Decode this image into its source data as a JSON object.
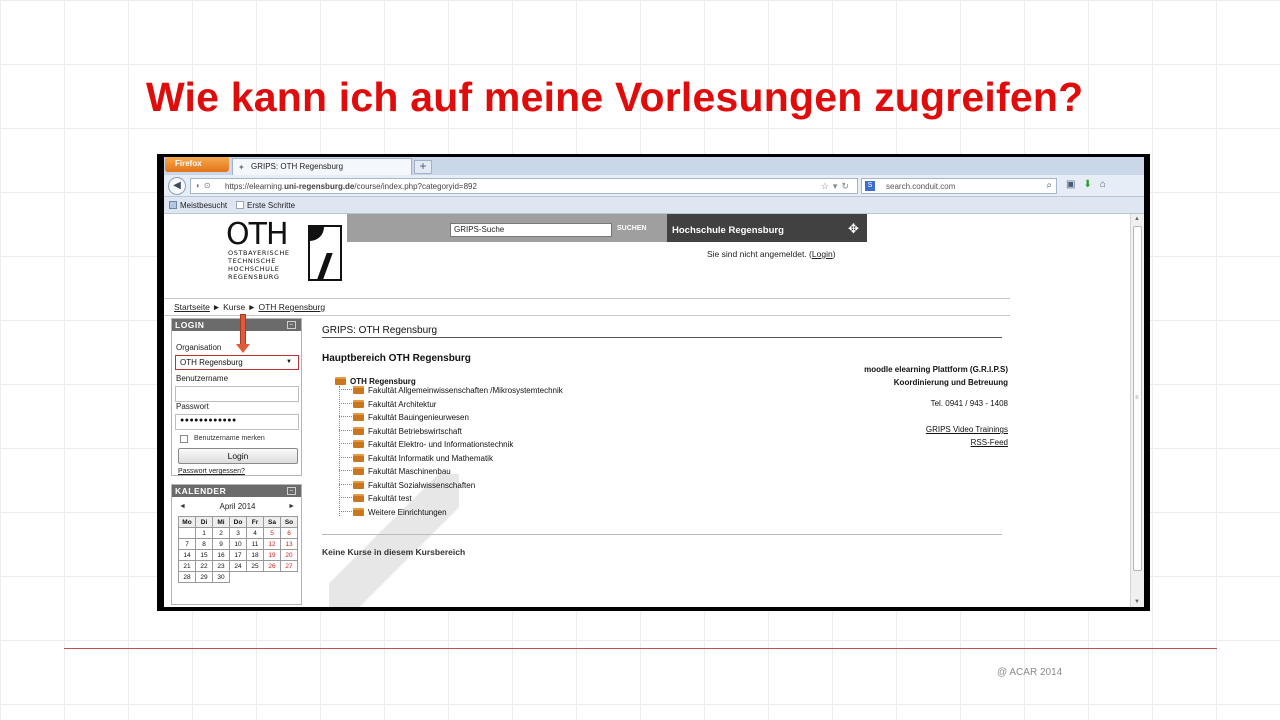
{
  "slide": {
    "title": "Wie kann ich auf meine Vorlesungen zugreifen?",
    "footer": "@ ACAR 2014",
    "accent_color": "#e00b0b"
  },
  "browser": {
    "menu_button": "Firefox",
    "tab_title": "GRIPS: OTH Regensburg",
    "url_prefix": "https://elearning.",
    "url_domain": "uni-regensburg.de",
    "url_path": "/course/index.php?categoryid=892",
    "search_value": "search.conduit.com",
    "bookmarks": [
      "Meistbesucht",
      "Erste Schritte"
    ]
  },
  "page": {
    "logo": {
      "main": "OTH",
      "lines": [
        "OSTBAYERISCHE",
        "TECHNISCHE",
        "HOCHSCHULE",
        "REGENSBURG"
      ]
    },
    "search": {
      "value": "GRIPS-Suche",
      "button": "SUCHEN"
    },
    "brand_bar": "Hochschule Regensburg",
    "login_status_prefix": "Sie sind nicht angemeldet. (",
    "login_link": "Login",
    "login_status_suffix": ")",
    "breadcrumb": [
      "Startseite",
      "Kurse",
      "OTH Regensburg"
    ],
    "login_block": {
      "header": "LOGIN",
      "org_label": "Organisation",
      "org_value": "OTH Regensburg",
      "user_label": "Benutzername",
      "user_value": "",
      "pass_label": "Passwort",
      "pass_value": "●●●●●●●●●●●●",
      "remember_label": "Benutzername merken",
      "login_button": "Login",
      "forgot_link": "Passwort vergessen?"
    },
    "calendar": {
      "header": "KALENDER",
      "month": "April 2014",
      "weekdays": [
        "Mo",
        "Di",
        "Mi",
        "Do",
        "Fr",
        "Sa",
        "So"
      ],
      "weeks": [
        [
          "",
          "1",
          "2",
          "3",
          "4",
          "5",
          "6"
        ],
        [
          "7",
          "8",
          "9",
          "10",
          "11",
          "12",
          "13"
        ],
        [
          "14",
          "15",
          "16",
          "17",
          "18",
          "19",
          "20"
        ],
        [
          "21",
          "22",
          "23",
          "24",
          "25",
          "26",
          "27"
        ],
        [
          "28",
          "29",
          "30",
          "",
          "",
          "",
          ""
        ]
      ]
    },
    "main": {
      "title": "GRIPS: OTH Regensburg",
      "category": "Hauptbereich OTH Regensburg",
      "tree_root": "OTH Regensburg",
      "tree_items": [
        "Fakultät Allgemeinwissenschaften /Mikrosystemtechnik",
        "Fakultät Architektur",
        "Fakultät Bauingenieurwesen",
        "Fakultät Betriebswirtschaft",
        "Fakultät Elektro- und Informationstechnik",
        "Fakultät Informatik und Mathematik",
        "Fakultät Maschinenbau",
        "Fakultät Sozialwissenschaften",
        "Fakultät test",
        "Weitere Einrichtungen"
      ],
      "info_line1": "moodle elearning Plattform (G.R.I.P.S)",
      "info_line2": "Koordinierung und Betreuung",
      "info_phone": "Tel. 0941 / 943 - 1408",
      "info_link1": "GRIPS Video Trainings",
      "info_link2": "RSS-Feed",
      "no_courses": "Keine Kurse in diesem Kursbereich"
    }
  }
}
